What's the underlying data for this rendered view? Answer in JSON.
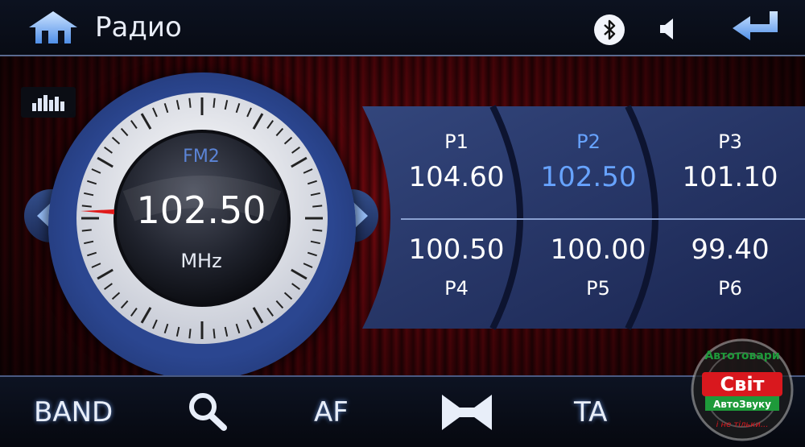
{
  "header": {
    "title": "Радио"
  },
  "tuner": {
    "band": "FM2",
    "frequency": "102.50",
    "unit": "MHz"
  },
  "presets": [
    {
      "label": "P1",
      "frequency": "104.60",
      "active": false
    },
    {
      "label": "P2",
      "frequency": "102.50",
      "active": true
    },
    {
      "label": "P3",
      "frequency": "101.10",
      "active": false
    },
    {
      "label": "P4",
      "frequency": "100.50",
      "active": false
    },
    {
      "label": "P5",
      "frequency": "100.00",
      "active": false
    },
    {
      "label": "P6",
      "frequency": "99.40",
      "active": false
    }
  ],
  "bottom": {
    "band_label": "BAND",
    "af_label": "AF",
    "ta_label": "TA"
  },
  "watermark": {
    "top_text": "Автотовари",
    "brand": "Світ",
    "sub": "АвтоЗвуку",
    "tagline": "і не тільки..."
  },
  "icons": {
    "home": "home-icon",
    "bluetooth": "bluetooth-icon",
    "volume": "speaker-icon",
    "back": "return-arrow-icon",
    "equalizer": "equalizer-icon",
    "prev": "seek-back-icon",
    "next": "seek-forward-icon",
    "search": "search-icon",
    "seek": "bowtie-icon"
  },
  "colors": {
    "accent": "#67a3ff",
    "panel": "#2b4690"
  }
}
